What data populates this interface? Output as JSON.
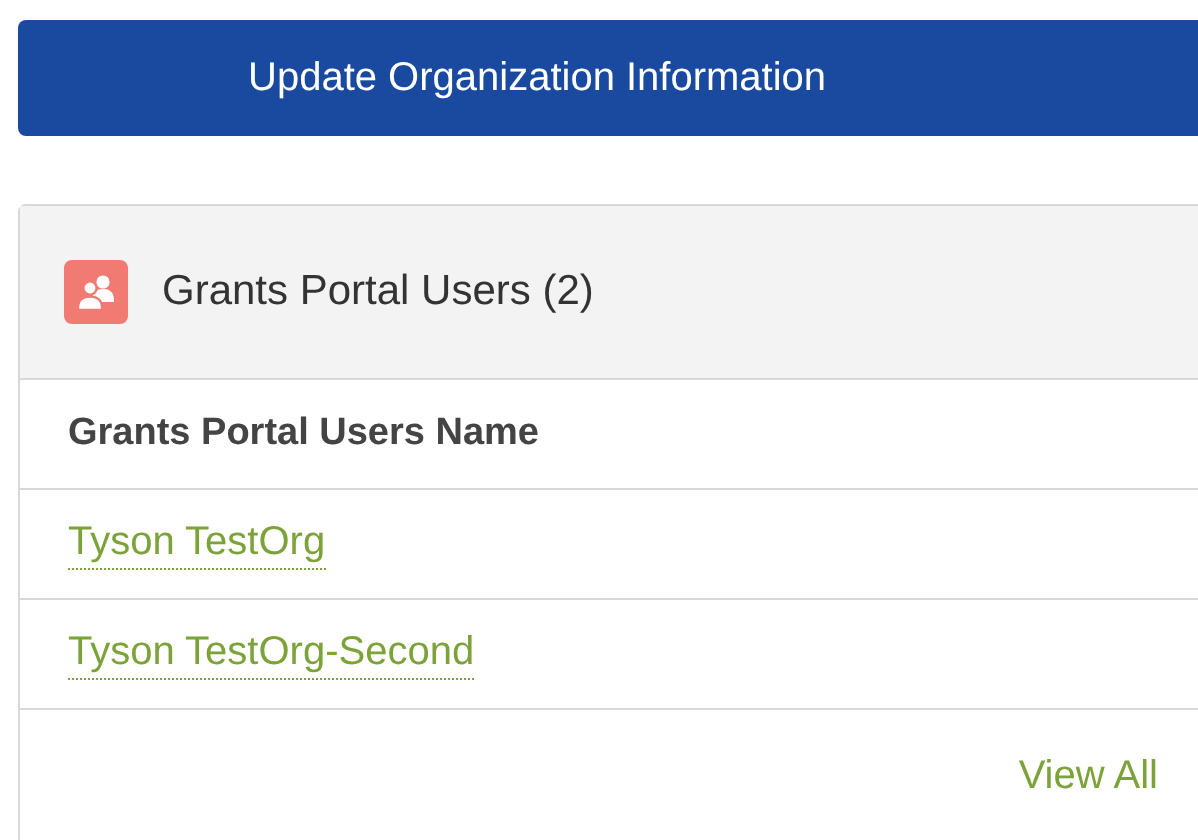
{
  "update_button": {
    "label": "Update Organization Information"
  },
  "card": {
    "title": "Grants Portal Users",
    "count": "(2)",
    "table": {
      "columns": [
        "Grants Portal Users Name"
      ],
      "rows": [
        {
          "name": "Tyson TestOrg"
        },
        {
          "name": "Tyson TestOrg-Second"
        }
      ]
    },
    "footer_link": "View All"
  }
}
